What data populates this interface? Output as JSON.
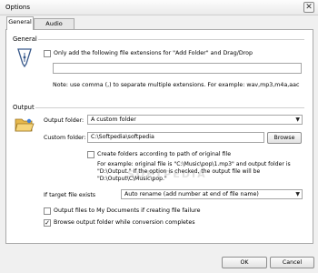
{
  "window": {
    "title": "Options",
    "close_glyph": "✕"
  },
  "tabs": [
    {
      "label": "General",
      "active": true
    },
    {
      "label": "Audio Options",
      "active": false
    }
  ],
  "general": {
    "section_label": "General",
    "add_ext_checkbox": {
      "label": "Only add the following file extensions for \"Add Folder\" and Drag/Drop",
      "checked": false
    },
    "extensions_value": "",
    "note": "Note: use comma (,) to separate multiple extensions. For example: wav,mp3,m4a,aac"
  },
  "output": {
    "section_label": "Output",
    "folder_label": "Output folder:",
    "folder_value": "A custom folder",
    "custom_label": "Custom folder:",
    "custom_value": "C:\\Softpedia\\softpedia",
    "browse_label": "Browse",
    "create_folders": {
      "label": "Create folders according to path of original file",
      "checked": false
    },
    "example_lines": [
      "For example: original file is \"C:\\Music\\pop\\1.mp3\" and output folder is",
      "\"D:\\Output.\" If the option is checked, the output file will be",
      "\"D:\\Output\\C\\Music\\pop.\""
    ],
    "exists_label": "If target file exists",
    "exists_value": "Auto rename (add number at end of file name)",
    "mydocs": {
      "label": "Output files to My Documents if creating file failure",
      "checked": false
    },
    "browse_after": {
      "label": "Browse output folder while conversion completes",
      "checked": true
    }
  },
  "watermark": "SOFTPEDIA",
  "buttons": {
    "ok": "OK",
    "cancel": "Cancel"
  },
  "colors": {
    "panel": "#ffffff",
    "frame": "#f0f0f0"
  }
}
